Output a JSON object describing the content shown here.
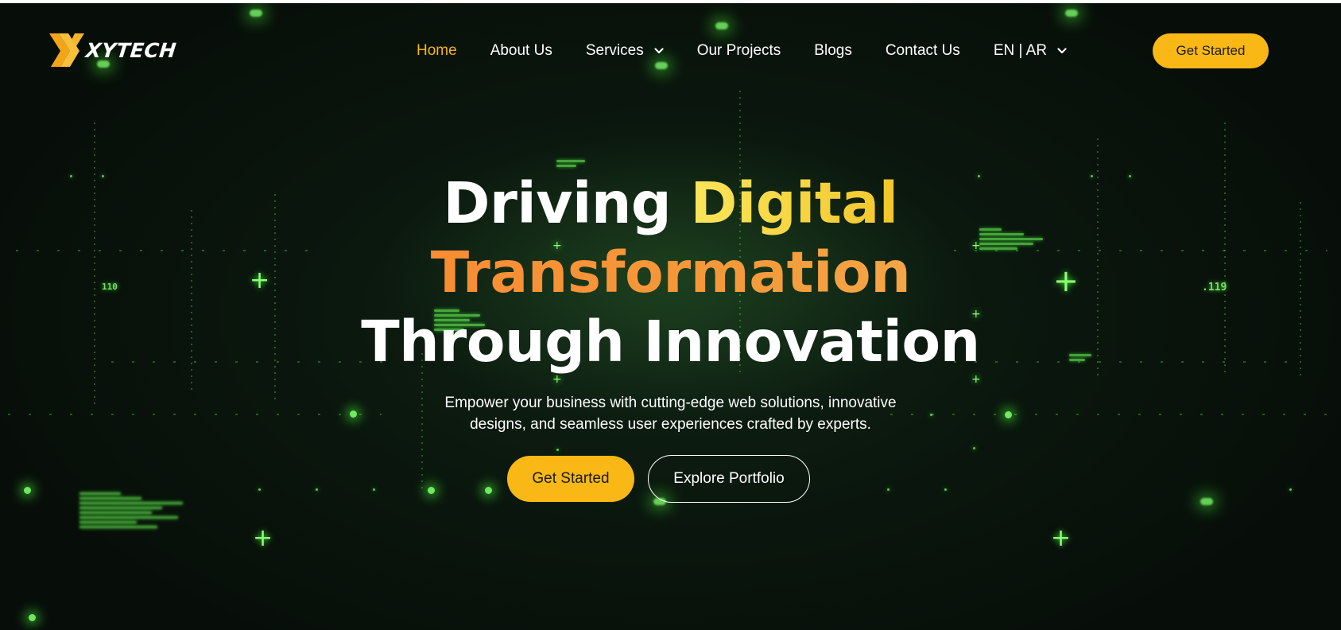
{
  "brand": {
    "name": "XYTECH",
    "logo_icon": "xy-logo-icon"
  },
  "nav": {
    "items": [
      {
        "label": "Home",
        "active": true
      },
      {
        "label": "About Us"
      },
      {
        "label": "Services",
        "icon": "chevron-down-icon"
      },
      {
        "label": "Our Projects"
      },
      {
        "label": "Blogs"
      },
      {
        "label": "Contact Us"
      },
      {
        "label": "EN | AR",
        "icon": "chevron-down-icon"
      }
    ],
    "cta_label": "Get Started"
  },
  "hero": {
    "headline_line1_white": "Driving ",
    "headline_line1_accent": "Digital",
    "headline_line2": "Transformation",
    "headline_line3": "Through Innovation",
    "subtitle_line1": "Empower your business with cutting-edge web solutions, innovative",
    "subtitle_line2": "designs, and seamless user experiences crafted by experts.",
    "primary_button": "Get Started",
    "secondary_button": "Explore Portfolio"
  },
  "decor": {
    "code_number_left": "110",
    "code_number_right": ".119"
  },
  "colors": {
    "accent": "#f9b816",
    "nav_active": "#f5b417",
    "headline_yellow": "#f7d53d",
    "headline_orange": "#ff7a2a",
    "background": "#0a160d",
    "particle": "#4dff3a"
  }
}
